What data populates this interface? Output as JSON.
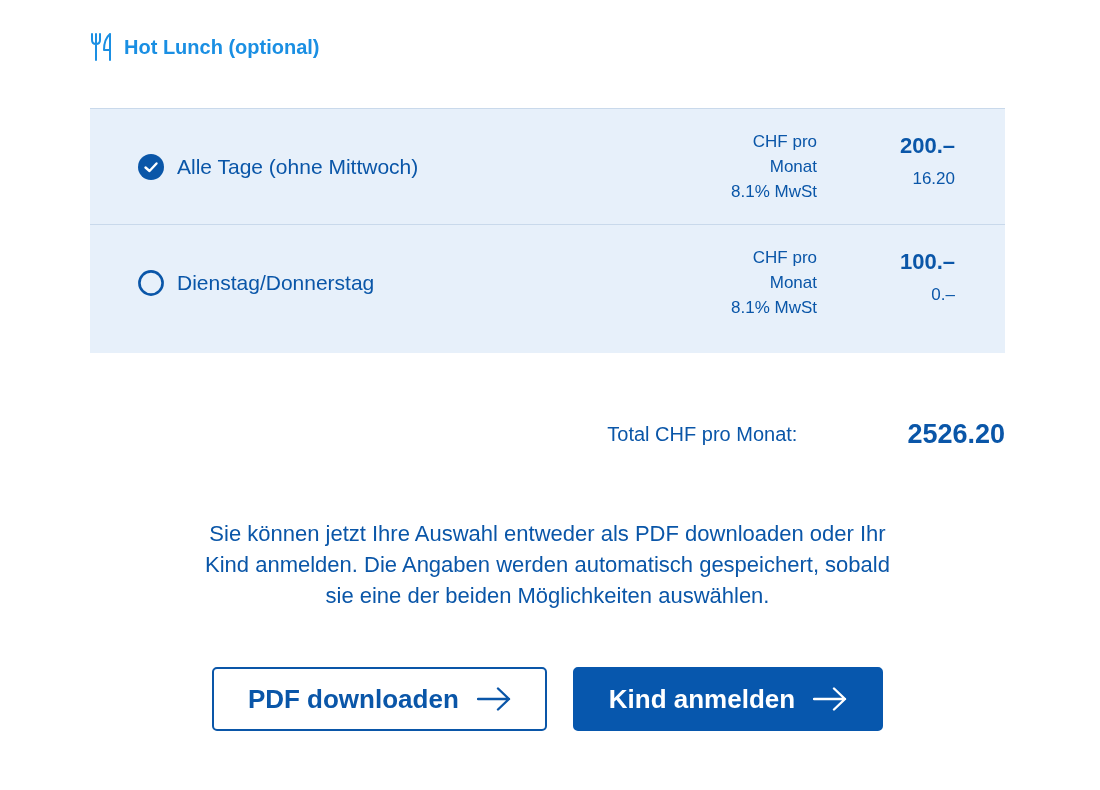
{
  "section": {
    "title": "Hot Lunch (optional)"
  },
  "options": [
    {
      "label": "Alle Tage (ohne Mittwoch)",
      "selected": true,
      "unit": "CHF pro Monat",
      "vat_label": "8.1% MwSt",
      "price": "200.–",
      "vat": "16.20"
    },
    {
      "label": "Dienstag/Donnerstag",
      "selected": false,
      "unit": "CHF pro Monat",
      "vat_label": "8.1% MwSt",
      "price": "100.–",
      "vat": "0.–"
    }
  ],
  "total": {
    "label": "Total CHF pro Monat:",
    "value": "2526.20"
  },
  "note": "Sie können jetzt Ihre Auswahl entweder als PDF downloaden oder Ihr Kind anmelden. Die Angaben werden automatisch gespeichert, sobald sie eine der beiden Möglichkeiten auswählen.",
  "buttons": [
    {
      "label": "PDF downloaden",
      "kind": "secondary"
    },
    {
      "label": "Kind anmelden",
      "kind": "primary"
    }
  ]
}
